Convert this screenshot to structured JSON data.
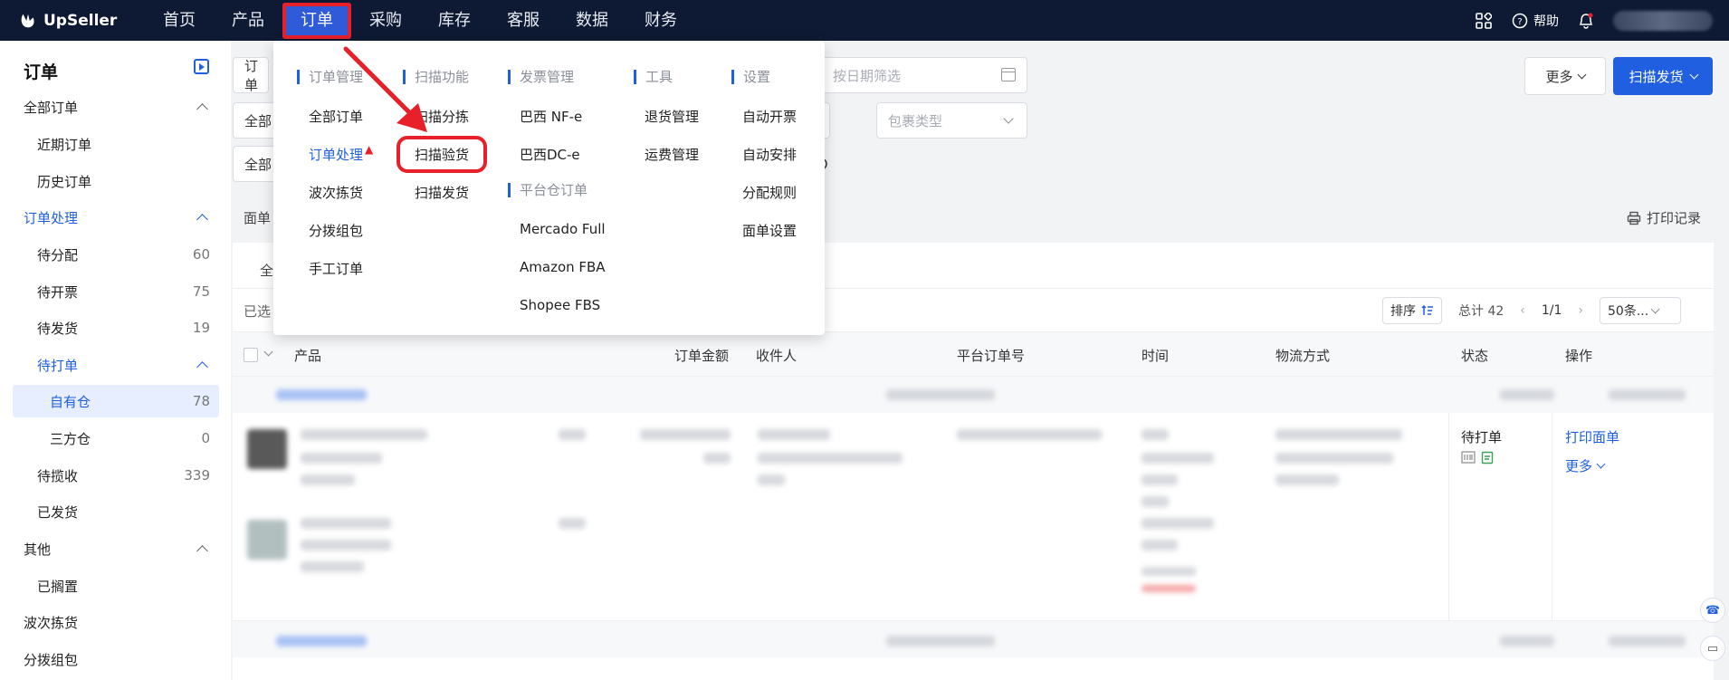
{
  "app": {
    "brand": "UpSeller"
  },
  "topnav": {
    "items": [
      {
        "label": "首页"
      },
      {
        "label": "产品"
      },
      {
        "label": "订单"
      },
      {
        "label": "采购"
      },
      {
        "label": "库存"
      },
      {
        "label": "客服"
      },
      {
        "label": "数据"
      },
      {
        "label": "财务"
      }
    ],
    "active": "订单",
    "help_label": "帮助"
  },
  "sidebar": {
    "title": "订单",
    "items": [
      {
        "label": "全部订单",
        "level": 1,
        "expandable": true
      },
      {
        "label": "近期订单",
        "level": 2
      },
      {
        "label": "历史订单",
        "level": 2
      },
      {
        "label": "订单处理",
        "level": 1,
        "expandable": true
      },
      {
        "label": "待分配",
        "level": 2,
        "count": "60"
      },
      {
        "label": "待开票",
        "level": 2,
        "count": "75"
      },
      {
        "label": "待发货",
        "level": 2,
        "count": "19"
      },
      {
        "label": "待打单",
        "level": 2,
        "expandable": true
      },
      {
        "label": "自有仓",
        "level": 3,
        "count": "78",
        "selected": true
      },
      {
        "label": "三方仓",
        "level": 3,
        "count": "0"
      },
      {
        "label": "待揽收",
        "level": 2,
        "count": "339"
      },
      {
        "label": "已发货",
        "level": 2
      },
      {
        "label": "其他",
        "level": 1,
        "expandable": true
      },
      {
        "label": "已搁置",
        "level": 2
      },
      {
        "label": "波次拣货",
        "level": 1
      },
      {
        "label": "分拨组包",
        "level": 1
      }
    ]
  },
  "filters": {
    "field1_partial": "订单",
    "field2_partial": "全部",
    "field3_partial": "全部",
    "date_placeholder": "按日期筛选",
    "package_type_placeholder": "包裹类型",
    "more_label": "更多",
    "scan_ship_label": "扫描发货"
  },
  "toolbar": {
    "tab_partial": "面单",
    "print_record_label": "打印记录",
    "tab2_partial": "全",
    "selected_partial": "已选",
    "sort_label": "排序",
    "total_label": "总计 42",
    "page_label": "1/1",
    "page_size_label": "50条..."
  },
  "table": {
    "headers": [
      "产品",
      "订单金额",
      "收件人",
      "平台订单号",
      "时间",
      "物流方式",
      "状态",
      "操作"
    ],
    "row1": {
      "status": "待打单",
      "action_print": "打印面单",
      "action_more": "更多"
    }
  },
  "dropdown": {
    "columns": [
      {
        "header": "订单管理",
        "items": [
          "全部订单",
          "订单处理",
          "波次拣货",
          "分拨组包",
          "手工订单"
        ]
      },
      {
        "header": "扫描功能",
        "items": [
          "扫描分拣",
          "扫描验货",
          "扫描发货"
        ]
      },
      {
        "header": "发票管理",
        "items": [
          "巴西 NF-e",
          "巴西DC-e"
        ],
        "sub_header": "平台仓订单",
        "sub_items": [
          "Mercado Full",
          "Amazon FBA",
          "Shopee FBS"
        ]
      },
      {
        "header": "工具",
        "items": [
          "退货管理",
          "运费管理"
        ]
      },
      {
        "header": "设置",
        "items": [
          "自动开票",
          "自动安排",
          "分配规则",
          "面单设置"
        ]
      }
    ],
    "highlighted_item": "扫描验货",
    "current_item": "订单处理"
  },
  "colors": {
    "topbar": "#0e1a33",
    "accent": "#1f5fe0",
    "highlight_red": "#e8202a"
  }
}
